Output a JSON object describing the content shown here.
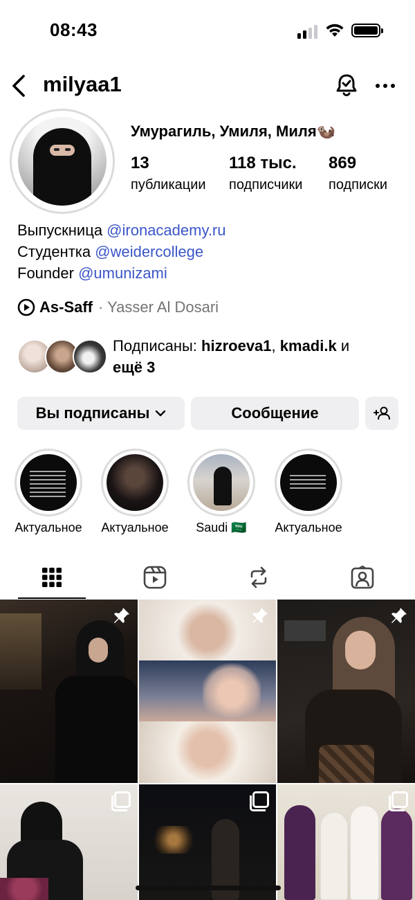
{
  "status_bar": {
    "time": "08:43"
  },
  "header": {
    "username": "milyaa1",
    "back_icon": "chevron-left-icon",
    "bell_icon": "bell-icon",
    "more_icon": "more-horizontal-icon"
  },
  "profile": {
    "display_name": "Умурагиль, Умиля, Миля🦦",
    "stats": [
      {
        "value": "13",
        "label": "публикации"
      },
      {
        "value": "118 тыс.",
        "label": "подписчики"
      },
      {
        "value": "869",
        "label": "подписки"
      }
    ],
    "bio": [
      {
        "text": "Выпускница ",
        "mention": "@ironacademy.ru"
      },
      {
        "text": "Студентка ",
        "mention": "@weidercollege"
      },
      {
        "text": "Founder ",
        "mention": "@umunizami"
      }
    ],
    "music": {
      "song": "As-Saff",
      "separator": " · ",
      "artist": "Yasser Al Dosari"
    },
    "followed_by": {
      "prefix": "Подписаны: ",
      "user1": "hizroeva1",
      "sep": ", ",
      "user2": "kmadi.k",
      "conj": " и",
      "more": "ещё 3"
    }
  },
  "buttons": {
    "following": "Вы подписаны",
    "message": "Сообщение",
    "add_user_icon": "add-user-icon"
  },
  "highlights": [
    {
      "label": "Актуальное"
    },
    {
      "label": "Актуальное"
    },
    {
      "label": "Saudi 🇸🇦"
    },
    {
      "label": "Актуальное"
    }
  ],
  "tabs": [
    "grid-icon",
    "reels-icon",
    "reposts-icon",
    "tagged-icon"
  ],
  "posts": [
    {
      "type": "pinned"
    },
    {
      "type": "pinned"
    },
    {
      "type": "pinned"
    },
    {
      "type": "carousel"
    },
    {
      "type": "carousel"
    },
    {
      "type": "carousel"
    }
  ],
  "colors": {
    "mention": "#3b56c8",
    "button_bg": "#efeff1",
    "muted": "#737373"
  }
}
